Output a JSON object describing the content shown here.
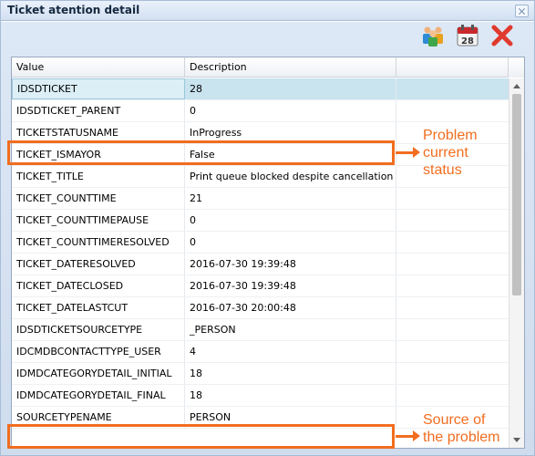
{
  "window": {
    "title": "Ticket atention detail"
  },
  "toolbar": {
    "icons": [
      "users-icon",
      "calendar-icon",
      "close-icon"
    ],
    "calendar_day": "28"
  },
  "grid": {
    "columns": [
      "Value",
      "Description",
      ""
    ],
    "rows": [
      {
        "value": "IDSDTICKET",
        "description": "28"
      },
      {
        "value": "IDSDTICKET_PARENT",
        "description": "0"
      },
      {
        "value": "TICKETSTATUSNAME",
        "description": "InProgress"
      },
      {
        "value": "TICKET_ISMAYOR",
        "description": "False"
      },
      {
        "value": "TICKET_TITLE",
        "description": "Print queue blocked despite cancellation"
      },
      {
        "value": "TICKET_COUNTTIME",
        "description": "21"
      },
      {
        "value": "TICKET_COUNTTIMEPAUSE",
        "description": "0"
      },
      {
        "value": "TICKET_COUNTTIMERESOLVED",
        "description": "0"
      },
      {
        "value": "TICKET_DATERESOLVED",
        "description": "2016-07-30 19:39:48"
      },
      {
        "value": "TICKET_DATECLOSED",
        "description": "2016-07-30 19:39:48"
      },
      {
        "value": "TICKET_DATELASTCUT",
        "description": "2016-07-30 20:00:48"
      },
      {
        "value": "IDSDTICKETSOURCETYPE",
        "description": "_PERSON"
      },
      {
        "value": "IDCMDBCONTACTTYPE_USER",
        "description": "4"
      },
      {
        "value": "IDMDCATEGORYDETAIL_INITIAL",
        "description": "18"
      },
      {
        "value": "IDMDCATEGORYDETAIL_FINAL",
        "description": "18"
      },
      {
        "value": "SOURCETYPENAME",
        "description": "PERSON"
      }
    ]
  },
  "annotations": {
    "status_line1": "Problem",
    "status_line2": "current",
    "status_line3": "status",
    "source_line1": "Source of",
    "source_line2": "the problem",
    "color": "#f26d1f"
  },
  "colors": {
    "selected_row": "#c9e3ef",
    "window_bg": "#d6e2f2"
  }
}
